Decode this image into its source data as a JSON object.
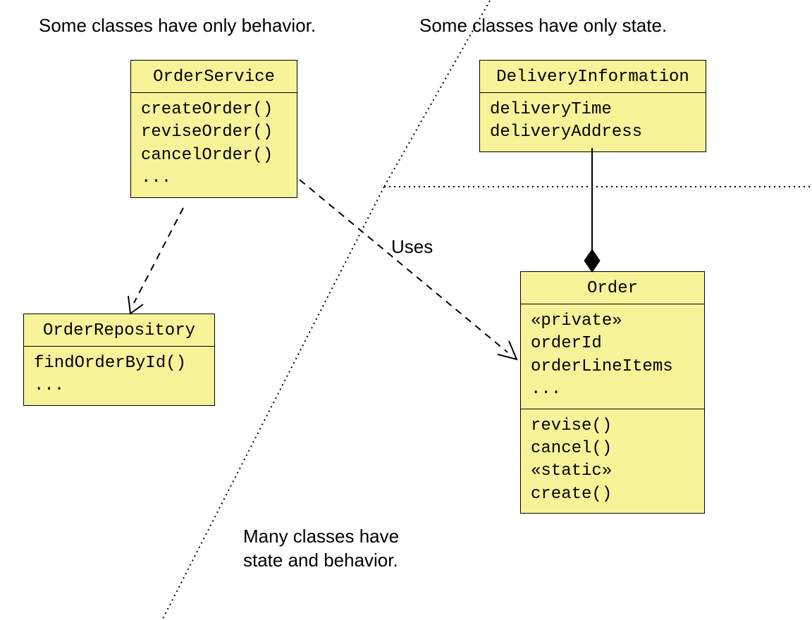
{
  "captions": {
    "behavior_only": "Some classes have only behavior.",
    "state_only": "Some classes have only state.",
    "both": "Many classes have\nstate and behavior."
  },
  "labels": {
    "uses": "Uses"
  },
  "classes": {
    "order_service": {
      "name": "OrderService",
      "methods": "createOrder()\nreviseOrder()\ncancelOrder()\n..."
    },
    "delivery_information": {
      "name": "DeliveryInformation",
      "attributes": "deliveryTime\ndeliveryAddress"
    },
    "order_repository": {
      "name": "OrderRepository",
      "methods": "findOrderById()\n..."
    },
    "order": {
      "name": "Order",
      "attributes": "«private»\norderId\norderLineItems\n...",
      "methods": "revise()\ncancel()\n«static»\ncreate()"
    }
  }
}
